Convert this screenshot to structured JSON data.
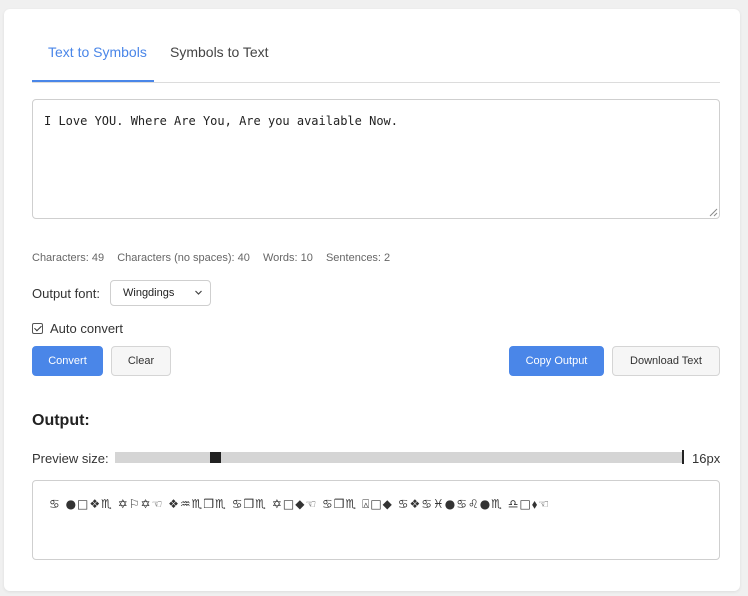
{
  "tabs": [
    {
      "label": "Text to Symbols",
      "active": true
    },
    {
      "label": "Symbols to Text",
      "active": false
    }
  ],
  "input": {
    "value": "I Love YOU. Where Are You, Are you available Now."
  },
  "stats": {
    "characters": "Characters: 49",
    "characters_no_spaces": "Characters (no spaces): 40",
    "words": "Words: 10",
    "sentences": "Sentences: 2"
  },
  "output_font": {
    "label": "Output font:",
    "selected": "Wingdings"
  },
  "auto_convert": {
    "label": "Auto convert",
    "checked": true
  },
  "buttons": {
    "convert": "Convert",
    "clear": "Clear",
    "copy_output": "Copy Output",
    "download_text": "Download Text"
  },
  "output": {
    "title": "Output:",
    "preview_label": "Preview size:",
    "preview_value": "16px",
    "preview_level": 0.17,
    "text": "♋ ●□❖♏ ✡⚐✡☜ ❖♒♏❒♏ ♋❒♏ ✡□◆☜ ♋❒♏ ⍓□◆ ♋❖♋♓●♋♌●♏ ♎□⬧☜"
  },
  "colors": {
    "accent": "#4a86e8",
    "border": "#cfcfcf",
    "page_bg": "#f0f0f0"
  }
}
